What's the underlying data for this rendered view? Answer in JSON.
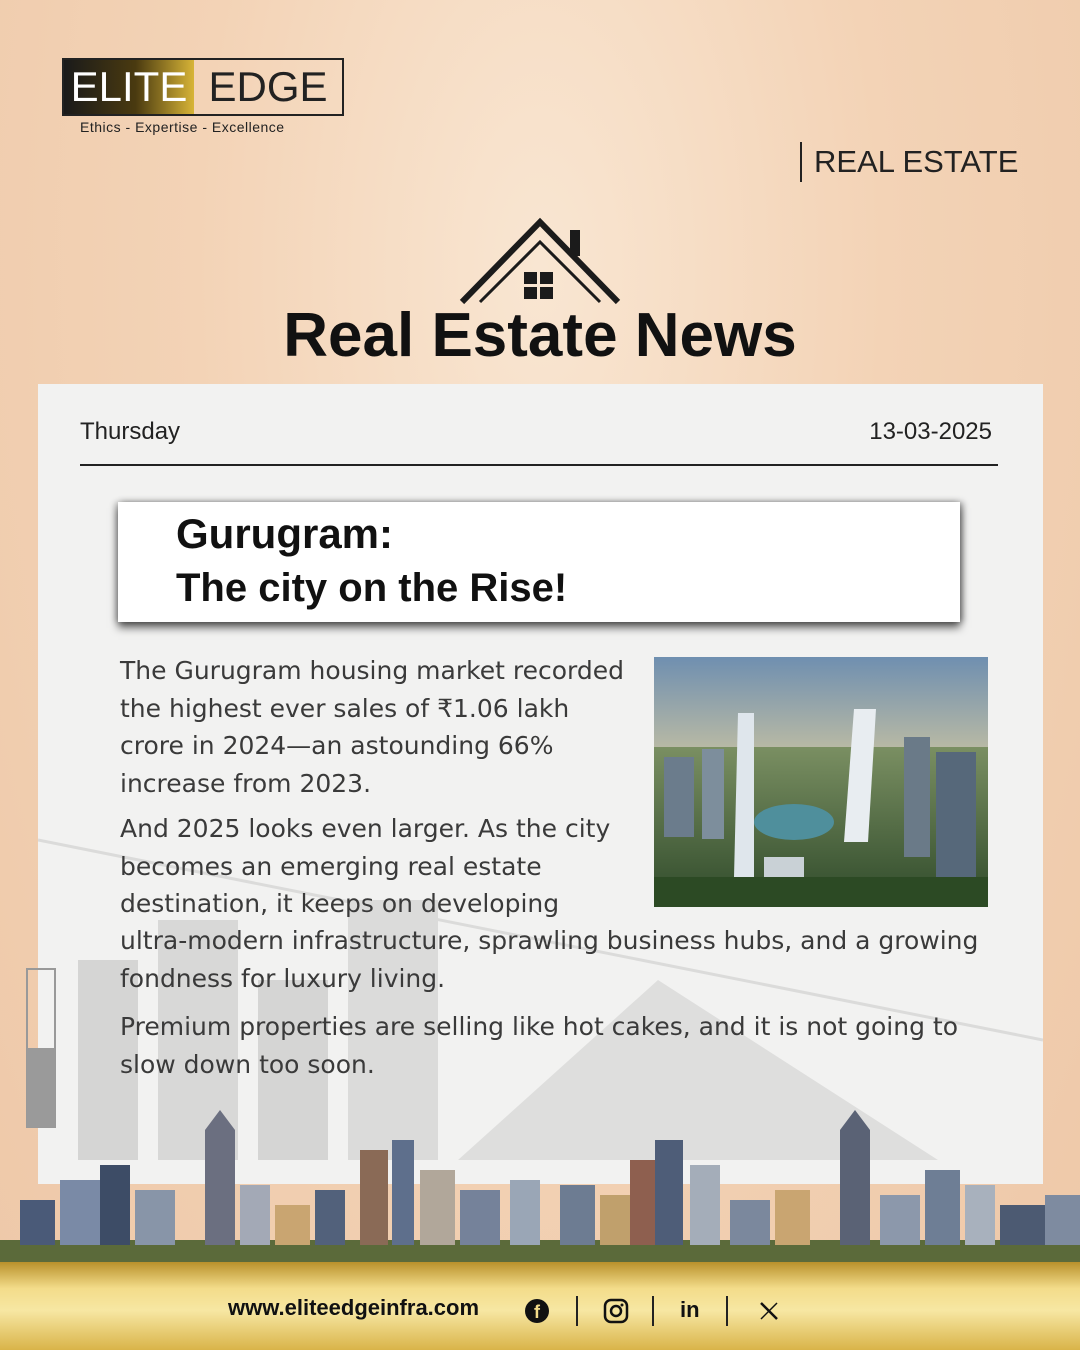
{
  "brand": {
    "logo_left": "ELITE",
    "logo_right": "EDGE",
    "tagline": "Ethics - Expertise - Excellence",
    "accent_gold": "#d7b437",
    "dark": "#1a1a1a"
  },
  "header": {
    "section_label": "REAL ESTATE",
    "title": "Real Estate News",
    "icon": "house-roof-icon"
  },
  "dateline": {
    "day": "Thursday",
    "date": "13-03-2025"
  },
  "article": {
    "headline_line1": "Gurugram:",
    "headline_line2": "The city on the Rise!",
    "paragraph1": "The Gurugram housing market recorded the highest ever sales of ₹1.06 lakh crore in 2024—an astounding 66% increase from 2023.",
    "paragraph2_start": "And 2025 looks even larger. As the city becomes an emerging real estate destination, it keeps on developing",
    "paragraph2_end": "ultra-modern infrastructure, sprawling business hubs, and a growing fondness for luxury living.",
    "paragraph3": "Premium properties are selling like hot cakes, and it is not going to slow down too soon.",
    "image": "city-skyscrapers-image"
  },
  "footer": {
    "website": "www.eliteedgeinfra.com",
    "social_icons": [
      "facebook-icon",
      "instagram-icon",
      "linkedin-icon",
      "x-icon"
    ],
    "linkedin_text": "in"
  }
}
